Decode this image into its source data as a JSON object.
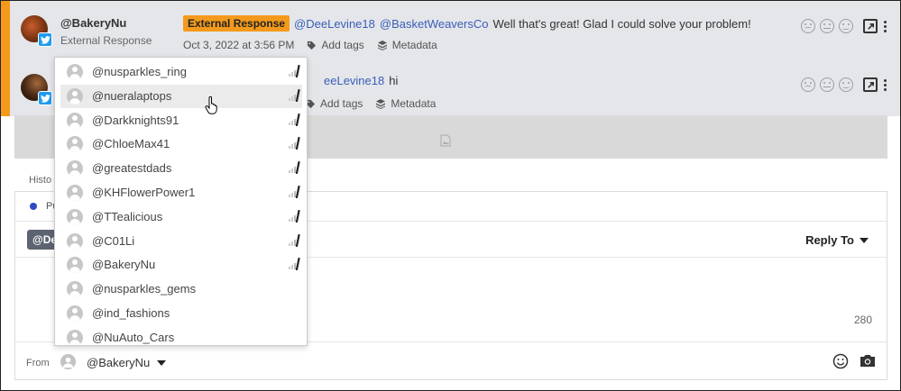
{
  "messages": [
    {
      "author": "@BakeryNu",
      "author_sub": "External Response",
      "tag": "External Response",
      "mentions": [
        "@DeeLevine18",
        "@BasketWeaversCo"
      ],
      "text": "Well that's great! Glad I could solve your problem!",
      "timestamp": "Oct 3, 2022 at 3:56 PM",
      "add_tags": "Add tags",
      "metadata": "Metadata"
    },
    {
      "mention_partial": "eeLevine18",
      "text": "hi",
      "add_tags": "Add tags",
      "metadata": "Metadata"
    }
  ],
  "composer": {
    "tab_partial": "Histo",
    "pub_partial": "Pu",
    "chip_partial": "@De",
    "reply_to": "Reply To",
    "char_count": "280",
    "from_label": "From",
    "from_account": "@BakeryNu"
  },
  "dropdown": {
    "items": [
      {
        "name": "@nusparkles_ring",
        "sig": true
      },
      {
        "name": "@nueralaptops",
        "sig": true
      },
      {
        "name": "@Darkknights91",
        "sig": true
      },
      {
        "name": "@ChloeMax41",
        "sig": true
      },
      {
        "name": "@greatestdads",
        "sig": true
      },
      {
        "name": "@KHFlowerPower1",
        "sig": true
      },
      {
        "name": "@TTealicious",
        "sig": true
      },
      {
        "name": "@C01Li",
        "sig": true
      },
      {
        "name": "@BakeryNu",
        "sig": true
      },
      {
        "name": "@nusparkles_gems",
        "sig": false
      },
      {
        "name": "@ind_fashions",
        "sig": false
      },
      {
        "name": "@NuAuto_Cars",
        "sig": false
      }
    ],
    "hover_index": 1
  },
  "colors": {
    "accent": "#f39a1c",
    "mention": "#3a5db8",
    "twitter": "#1d9bf0",
    "dot": "#2e49c2"
  }
}
